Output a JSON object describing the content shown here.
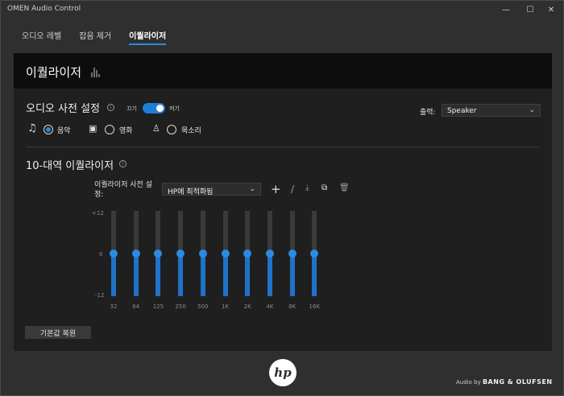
{
  "window": {
    "title": "OMEN Audio Control",
    "minimize": "—",
    "maximize": "☐",
    "close": "✕"
  },
  "tabs": [
    {
      "label": "오디오 레벨",
      "active": false
    },
    {
      "label": "잡음 제거",
      "active": false
    },
    {
      "label": "이퀄라이저",
      "active": true
    }
  ],
  "header": {
    "title": "이퀄라이저"
  },
  "presets": {
    "title": "오디오 사전 설정",
    "toggle_off": "끄기",
    "toggle_on": "켜기",
    "toggle_state": true,
    "output_label": "출력:",
    "output_value": "Speaker",
    "modes": [
      {
        "label": "음악",
        "icon": "music-note-icon",
        "selected": true
      },
      {
        "label": "영화",
        "icon": "movie-camera-icon",
        "selected": false
      },
      {
        "label": "목소리",
        "icon": "microphone-icon",
        "selected": false
      }
    ]
  },
  "eq": {
    "title": "10-대역 이퀄라이저",
    "preset_label": "이퀄라이저 사전 설정:",
    "preset_value": "HP에 최적화됨",
    "tools": [
      "add-icon",
      "edit-icon",
      "import-icon",
      "copy-icon",
      "delete-icon"
    ],
    "y_labels": [
      "+12",
      "0",
      "-12"
    ],
    "bands": [
      {
        "label": "32",
        "gain_db": 0
      },
      {
        "label": "64",
        "gain_db": 0
      },
      {
        "label": "125",
        "gain_db": 0
      },
      {
        "label": "250",
        "gain_db": 0
      },
      {
        "label": "500",
        "gain_db": 0
      },
      {
        "label": "1K",
        "gain_db": 0
      },
      {
        "label": "2K",
        "gain_db": 0
      },
      {
        "label": "4K",
        "gain_db": 0
      },
      {
        "label": "8K",
        "gain_db": 0
      },
      {
        "label": "16K",
        "gain_db": 0
      }
    ],
    "range": [
      -12,
      12
    ],
    "reset_label": "기본값 복원"
  },
  "footer": {
    "logo_text": "hp",
    "audio_by": "Audio by",
    "brand": "BANG & OLUFSEN"
  },
  "colors": {
    "accent": "#2a8be0",
    "fill": "#1f73c6",
    "panel": "#1f1f1f"
  }
}
